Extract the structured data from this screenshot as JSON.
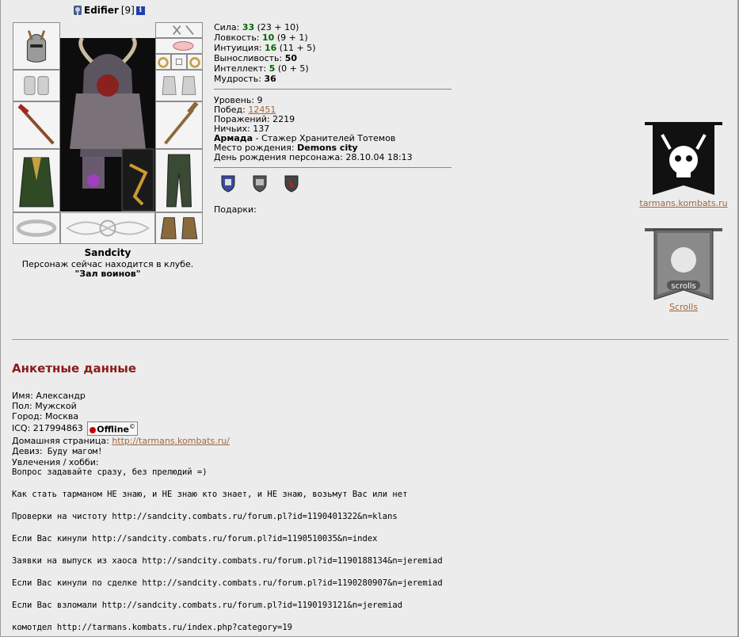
{
  "character": {
    "nick": "Edifier",
    "level": "[9]",
    "name_caption": "Sandcity",
    "location_text": "Персонаж сейчас находится в клубе.",
    "location_room": "\"Зал воинов\""
  },
  "stats": [
    {
      "label": "Сила:",
      "value": "33",
      "detail": "(23 + 10)",
      "highlight": true
    },
    {
      "label": "Ловкость:",
      "value": "10",
      "detail": "(9 + 1)",
      "highlight": true
    },
    {
      "label": "Интуиция:",
      "value": "16",
      "detail": "(11 + 5)",
      "highlight": true
    },
    {
      "label": "Выносливость:",
      "value": "50",
      "detail": "",
      "highlight": false
    },
    {
      "label": "Интеллект:",
      "value": "5",
      "detail": "(0 + 5)",
      "highlight": true
    },
    {
      "label": "Мудрость:",
      "value": "36",
      "detail": "",
      "highlight": false
    }
  ],
  "info": {
    "level_label": "Уровень:",
    "level_value": "9",
    "wins_label": "Побед:",
    "wins_value": "12451",
    "losses_label": "Поражений:",
    "losses_value": "2219",
    "draws_label": "Ничьих:",
    "draws_value": "137",
    "clan_name": "Армада",
    "clan_rank": " - Стажер Хранителей Тотемов",
    "birthplace_label": "Место рождения:",
    "birthplace_value": "Demons city",
    "birthday_label": "День рождения персонажа:",
    "birthday_value": "28.10.04 18:13"
  },
  "gifts_label": "Подарки:",
  "banners": [
    {
      "link": "tarmans.kombats.ru",
      "icon": "skull-banner-icon"
    },
    {
      "link": "Scrolls",
      "icon": "scrolls-banner-icon"
    }
  ],
  "profile": {
    "title": "Анкетные данные",
    "name_label": "Имя:",
    "name_value": "Александр",
    "gender_label": "Пол:",
    "gender_value": "Мужской",
    "city_label": "Город:",
    "city_value": "Москва",
    "icq_label": "ICQ:",
    "icq_value": "217994863",
    "icq_status": "Offline",
    "icq_mark": "©",
    "homepage_label": "Домашняя страница:",
    "homepage_value": "http://tarmans.kombats.ru/",
    "motto_label": "Девиз:",
    "motto_value": "Буду магом!",
    "hobby_label": "Увлечения / хобби:",
    "about_lines": [
      "Вопрос задавайте сразу, без прелюдий =)",
      "",
      "Как стать тарманом НЕ знаю, и НЕ знаю кто знает, и НЕ знаю, возьмут Вас или нет",
      "",
      "Проверки на чистоту http://sandcity.combats.ru/forum.pl?id=1190401322&n=klans",
      "",
      "Если Вас кинули http://sandcity.combats.ru/forum.pl?id=1190510035&n=index",
      "",
      "Заявки на выпуск из хаоса http://sandcity.combats.ru/forum.pl?id=1190188134&n=jeremiad",
      "",
      "Если Вас кинули по сделке http://sandcity.combats.ru/forum.pl?id=1190280907&n=jeremiad",
      "",
      "Если Вас взломали http://sandcity.combats.ru/forum.pl?id=1190193121&n=jeremiad",
      "",
      "комотдел http://tarmans.kombats.ru/index.php?category=19"
    ]
  },
  "colors": {
    "background": "#ececec",
    "stat_green": "#006600",
    "section_title": "#8b1a1a",
    "link": "#a0673f"
  }
}
